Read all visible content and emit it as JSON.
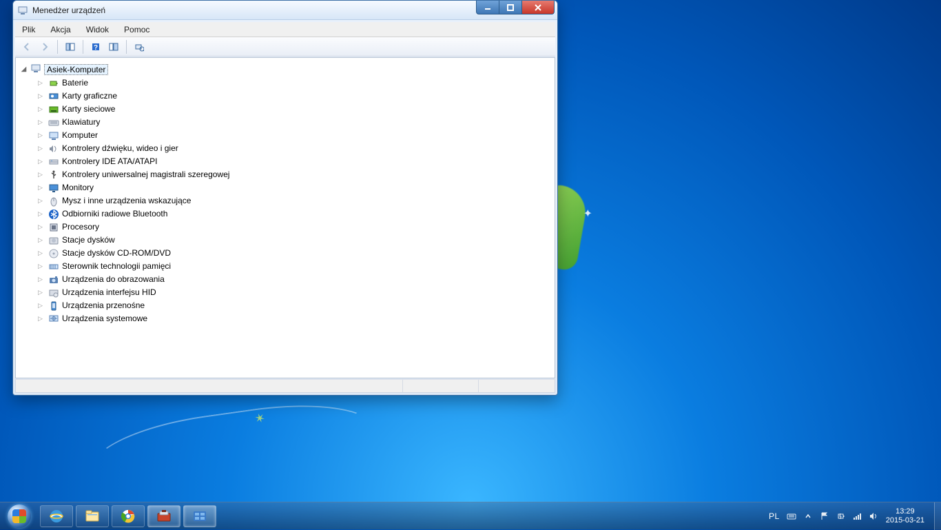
{
  "window": {
    "title": "Menedżer urządzeń",
    "menu": {
      "file": "Plik",
      "action": "Akcja",
      "view": "Widok",
      "help": "Pomoc"
    }
  },
  "tree": {
    "root": "Asiek-Komputer",
    "nodes": [
      {
        "label": "Baterie",
        "icon": "battery"
      },
      {
        "label": "Karty graficzne",
        "icon": "gpu"
      },
      {
        "label": "Karty sieciowe",
        "icon": "nic"
      },
      {
        "label": "Klawiatury",
        "icon": "keyboard"
      },
      {
        "label": "Komputer",
        "icon": "computer"
      },
      {
        "label": "Kontrolery dźwięku, wideo i gier",
        "icon": "sound"
      },
      {
        "label": "Kontrolery IDE ATA/ATAPI",
        "icon": "ide"
      },
      {
        "label": "Kontrolery uniwersalnej magistrali szeregowej",
        "icon": "usb"
      },
      {
        "label": "Monitory",
        "icon": "monitor"
      },
      {
        "label": "Mysz i inne urządzenia wskazujące",
        "icon": "mouse"
      },
      {
        "label": "Odbiorniki radiowe Bluetooth",
        "icon": "bluetooth"
      },
      {
        "label": "Procesory",
        "icon": "cpu"
      },
      {
        "label": "Stacje dysków",
        "icon": "disk"
      },
      {
        "label": "Stacje dysków CD-ROM/DVD",
        "icon": "cdrom"
      },
      {
        "label": "Sterownik technologii pamięci",
        "icon": "memtech"
      },
      {
        "label": "Urządzenia do obrazowania",
        "icon": "imaging"
      },
      {
        "label": "Urządzenia interfejsu HID",
        "icon": "hid"
      },
      {
        "label": "Urządzenia przenośne",
        "icon": "portable"
      },
      {
        "label": "Urządzenia systemowe",
        "icon": "system"
      }
    ]
  },
  "taskbar": {
    "lang": "PL",
    "time": "13:29",
    "date": "2015-03-21"
  }
}
